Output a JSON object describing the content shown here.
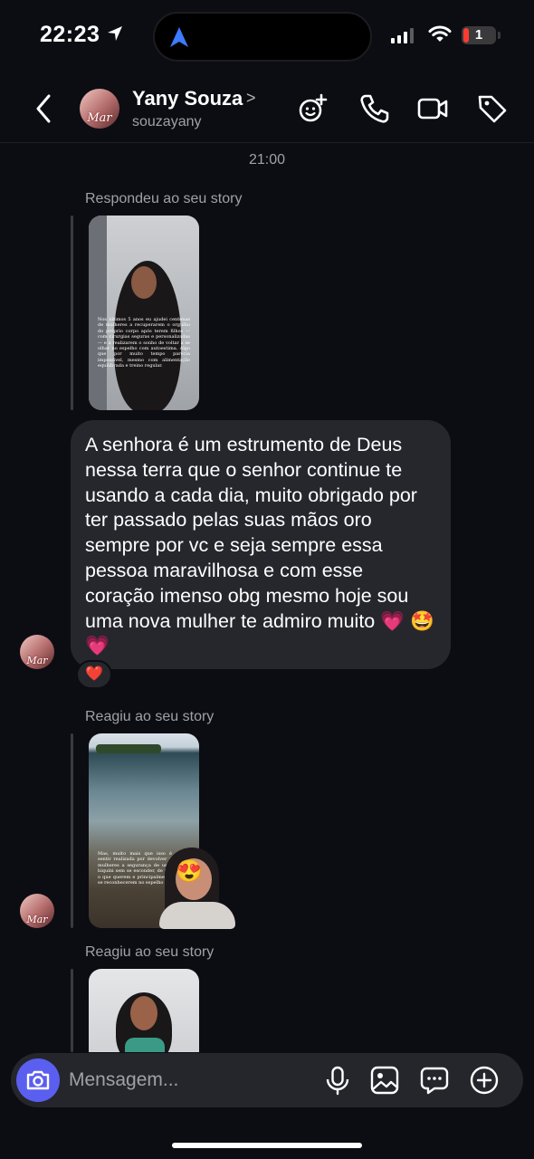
{
  "status_bar": {
    "time": "22:23",
    "battery": "1"
  },
  "header": {
    "contact_name": "Yany Souza",
    "contact_handle": "souzayany",
    "avatar_text": "Mar",
    "icons": [
      "back-icon",
      "effects-icon",
      "phone-icon",
      "video-icon",
      "tag-icon"
    ]
  },
  "chat": {
    "timestamp": "21:00",
    "story_reply_label": "Respondeu ao seu story",
    "story_1_text": "Nos últimos 5 anos eu ajudei centenas de mulheres a recuperarem o orgulho do próprio corpo após terem filhos — com cirurgias seguras e personalizadas — e a realizarem o sonho de voltar a se olhar no espelho com autoestima. Algo que por muito tempo parecia impossível, mesmo com alimentação equilibrada e treino regular.",
    "message": "A senhora é um estrumento de Deus nessa terra que o senhor continue te usando a cada dia, muito obrigado por ter passado pelas suas mãos oro sempre por vc e seja sempre essa pessoa maravilhosa e com esse coração imenso obg mesmo hoje sou uma nova mulher te admiro muito 💗 🤩💗",
    "reaction": "❤️",
    "story_react_label_1": "Reagiu ao seu story",
    "story_2_text": "Mas, muito mais que isso é sentir realizada por devolver a mulheres a segurança de usar biquíni sem se esconder, de ver o que querem e principalmente se reconhecerem no espelho",
    "memoji_reaction": "😍",
    "story_react_label_2": "Reagiu ao seu story"
  },
  "composer": {
    "placeholder": "Mensagem...",
    "icons": [
      "camera-icon",
      "microphone-icon",
      "image-icon",
      "sticker-icon",
      "plus-icon"
    ]
  },
  "colors": {
    "background": "#0c0d12",
    "bubble": "#26272d",
    "accent": "#5b5ff0",
    "muted_text": "#a0a1a7"
  }
}
